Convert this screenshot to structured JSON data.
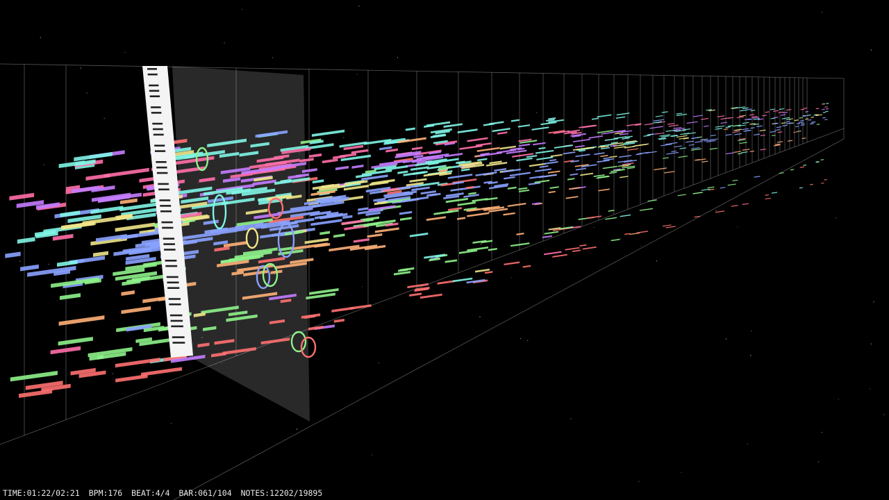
{
  "status": {
    "time": "TIME:01:22/02:21",
    "bpm": "BPM:176",
    "beat": "BEAT:4/4",
    "bar": "BAR:061/104",
    "notes": "NOTES:12202/19895"
  },
  "colors": {
    "background": "#000000",
    "grid": "#9a9a9a",
    "track_pink": "#ff6fa8",
    "track_violet": "#c47cff",
    "track_cyan": "#7ff5e6",
    "track_blue": "#8aa2ff",
    "track_yellow": "#f0e68a",
    "track_green": "#8ef28a",
    "track_red": "#ff7070",
    "track_orange": "#ffb077"
  },
  "icons": [
    "piano-keyboard-icon",
    "note-ripple-icon"
  ]
}
